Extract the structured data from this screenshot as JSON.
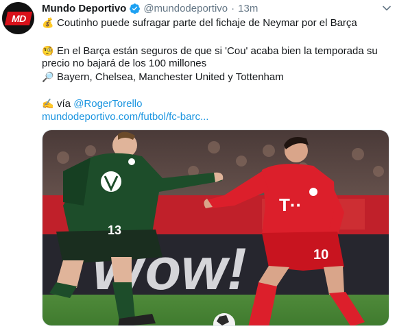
{
  "tweet": {
    "avatar_text": "MD",
    "display_name": "Mundo Deportivo",
    "verified": true,
    "handle": "@mundodeportivo",
    "separator": "·",
    "timestamp": "13m",
    "lines": [
      {
        "emoji": "moneybag-icon",
        "text": "Coutinho puede sufragar parte del fichaje de Neymar por el Barça"
      },
      {
        "emoji": "monocle-icon",
        "text": "En el Barça están seguros de que si 'Cou' acaba bien la temporada su"
      },
      {
        "text": "precio no bajará de los 100 millones"
      },
      {
        "emoji": "magnifier-icon",
        "text": "Bayern, Chelsea, Manchester United y Tottenham"
      }
    ],
    "via_label": "vía",
    "via_mention": "@RogerTorello",
    "article_link": "mundodeportivo.com/futbol/fc-barc...",
    "media": {
      "description_icon": "football-photo",
      "left_player_number": "13",
      "right_player_number": "10",
      "board_text": "Wow!"
    }
  },
  "colors": {
    "link": "#1b95e0",
    "secondary_text": "#657786",
    "verified_badge": "#1da1f2",
    "brand_red": "#d8121b"
  }
}
